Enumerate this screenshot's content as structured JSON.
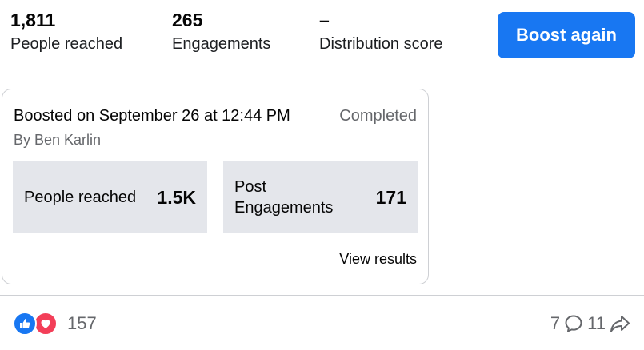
{
  "summary": {
    "reach": {
      "value": "1,811",
      "label": "People reached"
    },
    "engagements": {
      "value": "265",
      "label": "Engagements"
    },
    "distribution": {
      "value": "–",
      "label": "Distribution score"
    }
  },
  "boost_button_label": "Boost again",
  "boost_card": {
    "title": "Boosted on September 26 at 12:44 PM",
    "status": "Completed",
    "byline": "By Ben Karlin",
    "metrics": [
      {
        "label": "People reached",
        "value": "1.5K"
      },
      {
        "label": "Post\nEngagements",
        "value": "171"
      }
    ],
    "view_results_label": "View results"
  },
  "footer": {
    "reaction_icons": [
      "like-icon",
      "love-icon"
    ],
    "reaction_count": "157",
    "comment_count": "7",
    "share_count": "11"
  },
  "colors": {
    "accent": "#1877f2",
    "love": "#f33e58",
    "metric_bg": "#e4e6eb",
    "secondary_text": "#65676b"
  }
}
